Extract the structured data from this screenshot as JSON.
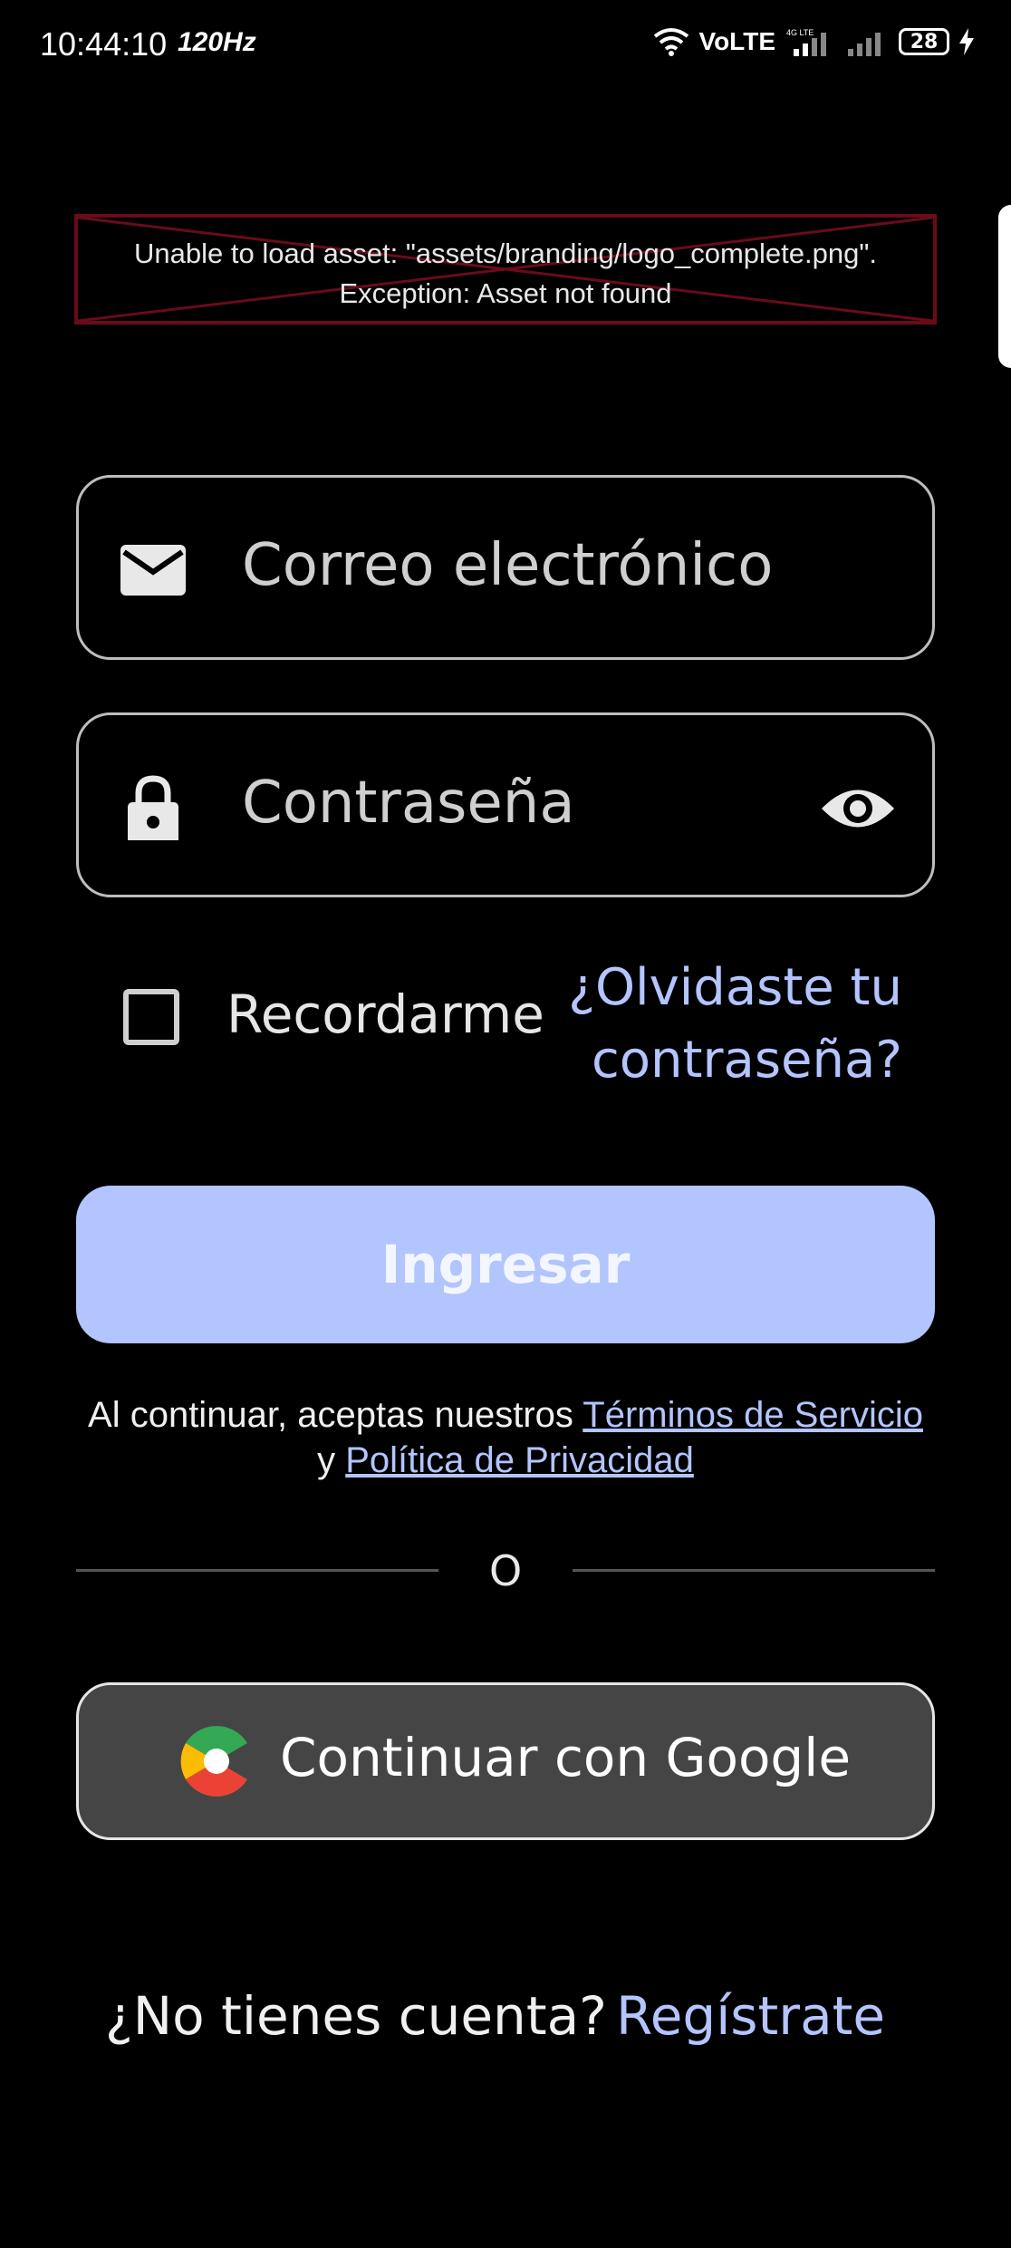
{
  "status_bar": {
    "time": "10:44:10",
    "refresh_rate": "120Hz",
    "network": "VoLTE",
    "network_type": "4G LTE",
    "battery": "28"
  },
  "logo_error": {
    "line1": "Unable to load asset: \"assets/branding/logo_complete.png\".",
    "line2": "Exception: Asset not found"
  },
  "email_field": {
    "placeholder": "Correo electrónico",
    "icon": "mail-icon"
  },
  "password_field": {
    "placeholder": "Contraseña",
    "icon": "lock-icon",
    "toggle_icon": "eye-icon"
  },
  "remember": {
    "label": "Recordarme",
    "checked": false
  },
  "forgot": {
    "line1": "¿Olvidaste tu",
    "line2": "contraseña?"
  },
  "login_button": {
    "label": "Ingresar"
  },
  "terms": {
    "prefix": "Al continuar, aceptas nuestros ",
    "terms_link": "Términos de Servicio",
    "connector": " y ",
    "privacy_link": "Política de Privacidad"
  },
  "divider": {
    "label": "O"
  },
  "google_button": {
    "label": "Continuar con Google",
    "icon": "google-icon"
  },
  "signup": {
    "prompt": "¿No tienes cuenta?",
    "link": "Regístrate"
  },
  "colors": {
    "accent": "#b4c4ff",
    "button_bg": "#b3c5ff",
    "error_border": "#6a0b1a",
    "google_bg": "#454545"
  }
}
